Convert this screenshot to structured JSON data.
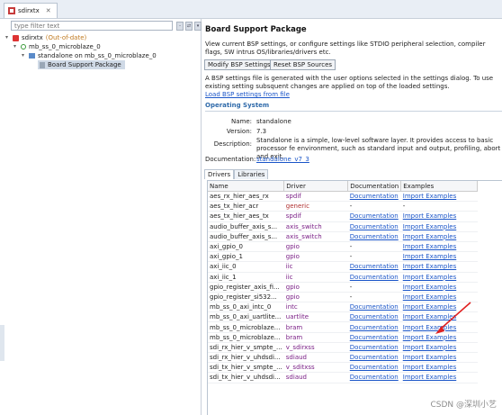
{
  "tab": {
    "title": "sdirxtx"
  },
  "left": {
    "filter_placeholder": "type filter text",
    "tree": [
      {
        "label": "sdirxtx",
        "suffix": "(Out-of-date)"
      },
      {
        "label": "mb_ss_0_microblaze_0"
      },
      {
        "label": "standalone on mb_ss_0_microblaze_0"
      },
      {
        "label": "Board Support Package"
      }
    ]
  },
  "right": {
    "title": "Board Support Package",
    "description": "View current BSP settings, or configure settings like STDIO peripheral selection, compiler flags, SW intrus OS/libraries/drivers etc.",
    "buttons": {
      "modify": "Modify BSP Settings...",
      "reset": "Reset BSP Sources"
    },
    "info_text": "A BSP settings file is generated with the user options selected in the settings dialog. To use existing setting subsquent changes are applied on top of the loaded settings.",
    "load_link": "Load BSP settings from file",
    "os_section": "Operating System",
    "os": {
      "name_label": "Name:",
      "name": "standalone",
      "version_label": "Version:",
      "version": "7.3",
      "desc_label": "Description:",
      "description": "Standalone is a simple, low-level software layer. It provides access to basic processor fe environment, such as standard input and output, profiling, abort and exit.",
      "doc_label": "Documentation:",
      "doc_link": "standalone_v7_3"
    },
    "subtabs": [
      "Drivers",
      "Libraries"
    ],
    "table": {
      "headers": [
        "Name",
        "Driver",
        "Documentation",
        "Examples"
      ],
      "rows": [
        [
          "aes_rx_hier_aes_rx",
          "spdif",
          "Documentation",
          "Import Examples"
        ],
        [
          "aes_tx_hier_acr",
          "generic",
          "-",
          "-"
        ],
        [
          "aes_tx_hier_aes_tx",
          "spdif",
          "Documentation",
          "Import Examples"
        ],
        [
          "audio_buffer_axis_s...",
          "axis_switch",
          "Documentation",
          "Import Examples"
        ],
        [
          "audio_buffer_axis_s...",
          "axis_switch",
          "Documentation",
          "Import Examples"
        ],
        [
          "axi_gpio_0",
          "gpio",
          "-",
          "Import Examples"
        ],
        [
          "axi_gpio_1",
          "gpio",
          "-",
          "Import Examples"
        ],
        [
          "axi_iic_0",
          "iic",
          "Documentation",
          "Import Examples"
        ],
        [
          "axi_iic_1",
          "iic",
          "Documentation",
          "Import Examples"
        ],
        [
          "gpio_register_axis_fi...",
          "gpio",
          "-",
          "Import Examples"
        ],
        [
          "gpio_register_si532...",
          "gpio",
          "-",
          "Import Examples"
        ],
        [
          "mb_ss_0_axi_intc_0",
          "intc",
          "Documentation",
          "Import Examples"
        ],
        [
          "mb_ss_0_axi_uartlite...",
          "uartlite",
          "Documentation",
          "Import Examples"
        ],
        [
          "mb_ss_0_microblaze...",
          "bram",
          "Documentation",
          "Import Examples"
        ],
        [
          "mb_ss_0_microblaze...",
          "bram",
          "Documentation",
          "Import Examples"
        ],
        [
          "sdi_rx_hier_v_smpte_...",
          "v_sdirxss",
          "Documentation",
          "Import Examples"
        ],
        [
          "sdi_rx_hier_v_uhdsdi...",
          "sdiaud",
          "Documentation",
          "Import Examples"
        ],
        [
          "sdi_tx_hier_v_smpte_...",
          "v_sditxss",
          "Documentation",
          "Import Examples"
        ],
        [
          "sdi_tx_hier_v_uhdsdi...",
          "sdiaud",
          "Documentation",
          "Import Examples"
        ]
      ]
    }
  },
  "watermark": "CSDN @深圳小艺",
  "colors": {
    "link": "#1a55c8",
    "driver": "#7a1f86",
    "section": "#2f6aaa",
    "arrow": "#e02020"
  }
}
